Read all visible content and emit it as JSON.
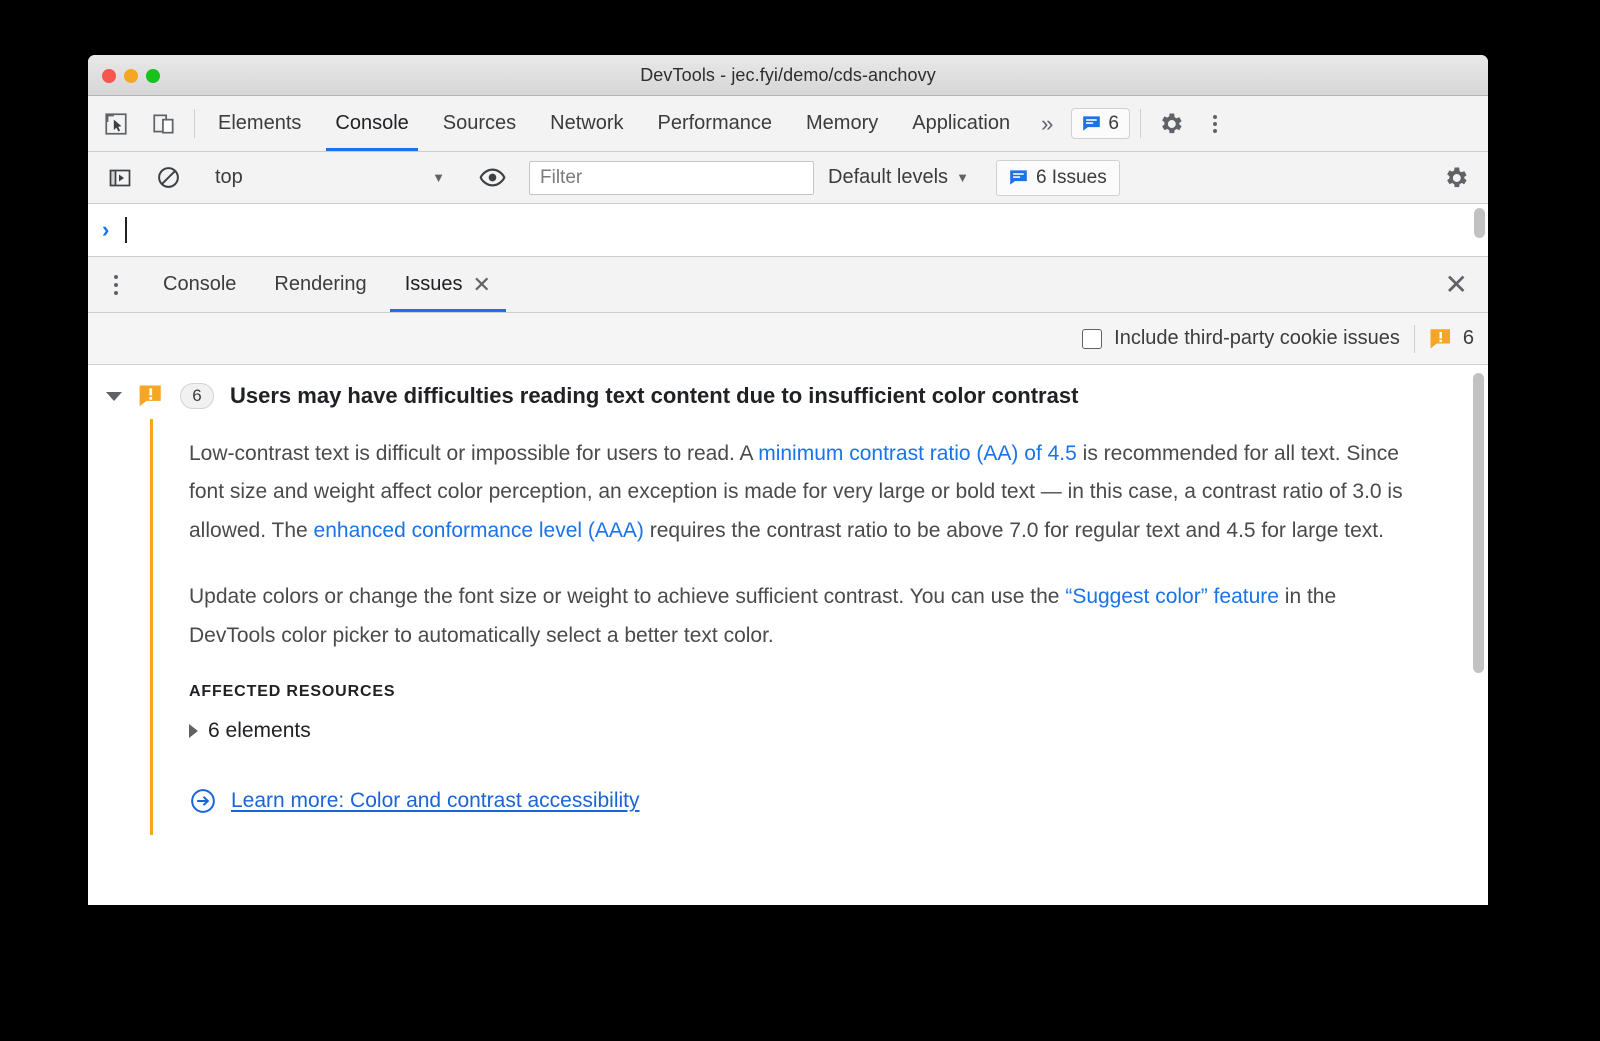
{
  "window": {
    "title": "DevTools - jec.fyi/demo/cds-anchovy",
    "traffic_lights": [
      "close",
      "minimize",
      "maximize"
    ]
  },
  "main_tabbar": {
    "icons": [
      "inspect-element-icon",
      "device-toolbar-icon"
    ],
    "tabs": [
      {
        "label": "Elements",
        "active": false
      },
      {
        "label": "Console",
        "active": true
      },
      {
        "label": "Sources",
        "active": false
      },
      {
        "label": "Network",
        "active": false
      },
      {
        "label": "Performance",
        "active": false
      },
      {
        "label": "Memory",
        "active": false
      },
      {
        "label": "Application",
        "active": false
      }
    ],
    "overflow_label": "»",
    "issue_badge_count": "6",
    "settings_icon": "gear-icon",
    "menu_icon": "kebab-menu-icon"
  },
  "console_toolbar": {
    "sidebar_toggle": "console-sidebar-icon",
    "clear_console": "clear-console-icon",
    "context": "top",
    "context_caret": "▼",
    "eye_icon": "live-expression-icon",
    "filter_placeholder": "Filter",
    "filter_value": "",
    "levels_label": "Default levels",
    "levels_caret": "▼",
    "issues_button_label": "6 Issues",
    "settings_icon": "gear-icon"
  },
  "console_prompt": {
    "arrow": "›",
    "value": ""
  },
  "drawer": {
    "menu_icon": "kebab-menu-icon",
    "tabs": [
      {
        "label": "Console",
        "active": false,
        "closable": false
      },
      {
        "label": "Rendering",
        "active": false,
        "closable": false
      },
      {
        "label": "Issues",
        "active": true,
        "closable": true
      }
    ],
    "tab_close_glyph": "✕",
    "drawer_close_glyph": "✕"
  },
  "issues_toolbar": {
    "checkbox_label": "Include third-party cookie issues",
    "checkbox_checked": false,
    "warning_icon": "warning-breakpoint-icon",
    "warning_count": "6"
  },
  "issue": {
    "expanded": true,
    "icon": "warning-issue-icon",
    "count": "6",
    "title": "Users may have difficulties reading text content due to insufficient color contrast",
    "paragraph1": {
      "part1": "Low-contrast text is difficult or impossible for users to read. A ",
      "link1": "minimum contrast ratio (AA) of 4.5",
      "part2": " is recommended for all text. Since font size and weight affect color perception, an exception is made for very large or bold text — in this case, a contrast ratio of 3.0 is allowed. The ",
      "link2": "enhanced conformance level (AAA)",
      "part3": " requires the contrast ratio to be above 7.0 for regular text and 4.5 for large text."
    },
    "paragraph2": {
      "part1": "Update colors or change the font size or weight to achieve sufficient contrast. You can use the ",
      "link1": "“Suggest color” feature",
      "part2": " in the DevTools color picker to automatically select a better text color."
    },
    "affected_resources_label": "AFFECTED RESOURCES",
    "affected_resources_value": "6 elements",
    "learn_more_icon": "circled-arrow-icon",
    "learn_more_label": "Learn more: Color and contrast accessibility"
  },
  "colors": {
    "accent_blue": "#1a73e8",
    "warning_orange": "#f5a623",
    "link_blue": "#1a65d6",
    "text_primary": "#202124",
    "text_body": "#4a4a4a"
  }
}
